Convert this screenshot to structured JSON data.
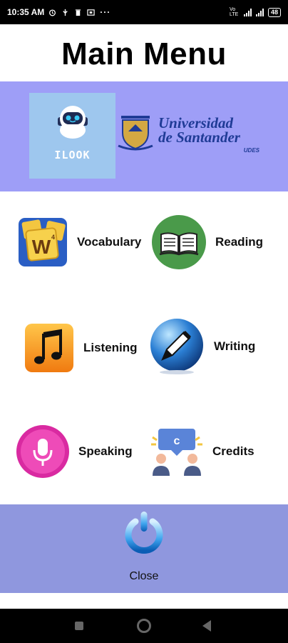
{
  "status_bar": {
    "time": "10:35 AM",
    "dots": "···",
    "battery": "48",
    "network_label": "Vo LTE"
  },
  "page": {
    "title": "Main Menu"
  },
  "banner": {
    "app_logo_text": "ILOOK",
    "university_name_line1": "Universidad",
    "university_name_line2": "de Santander",
    "university_abbr": "UDES",
    "background": "#9e9ef7"
  },
  "menu": {
    "items": [
      {
        "label": "Vocabulary",
        "icon": "vocabulary-icon"
      },
      {
        "label": "Reading",
        "icon": "book-icon"
      },
      {
        "label": "Listening",
        "icon": "music-note-icon"
      },
      {
        "label": "Writing",
        "icon": "pen-icon"
      },
      {
        "label": "Speaking",
        "icon": "microphone-icon"
      },
      {
        "label": "Credits",
        "icon": "credits-icon"
      }
    ]
  },
  "footer": {
    "close_label": "Close",
    "icon": "power-icon",
    "background": "#8f97de"
  }
}
